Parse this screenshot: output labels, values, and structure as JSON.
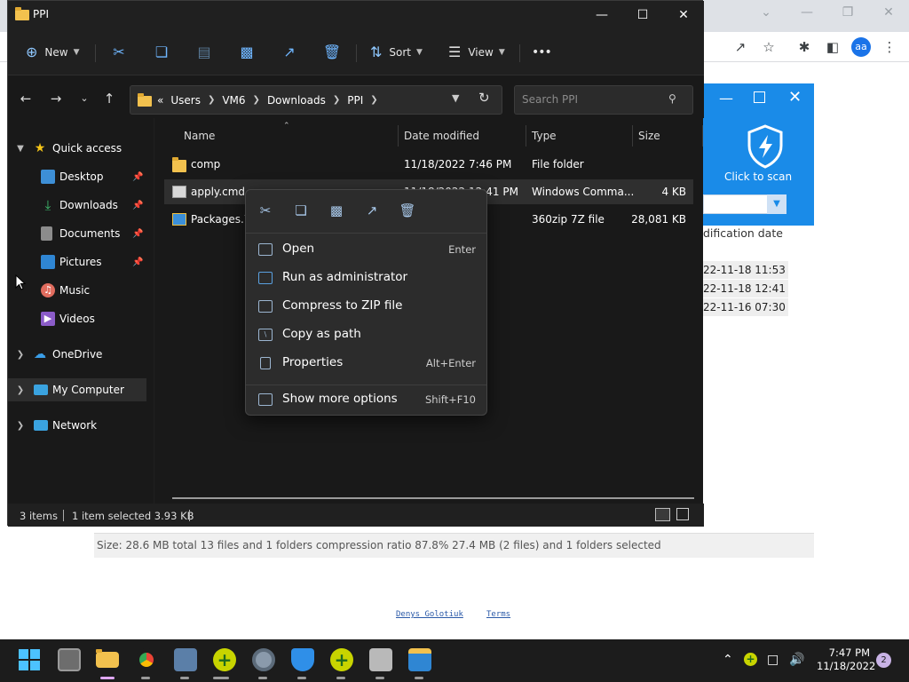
{
  "explorer": {
    "title": "PPI",
    "toolbar": {
      "new_label": "New",
      "sort_label": "Sort",
      "view_label": "View",
      "more_label": "•••"
    },
    "address": {
      "root": "«",
      "crumbs": [
        "Users",
        "VM6",
        "Downloads",
        "PPI"
      ]
    },
    "search": {
      "placeholder": "Search PPI"
    },
    "nav_pane": {
      "quick_access": "Quick access",
      "items": [
        "Desktop",
        "Downloads",
        "Documents",
        "Pictures",
        "Music",
        "Videos"
      ],
      "onedrive": "OneDrive",
      "my_computer": "My Computer",
      "network": "Network"
    },
    "columns": {
      "name": "Name",
      "date": "Date modified",
      "type": "Type",
      "size": "Size"
    },
    "files": [
      {
        "name": "comp",
        "date": "11/18/2022 7:46 PM",
        "type": "File folder",
        "size": ""
      },
      {
        "name": "apply.cmd",
        "date": "11/18/2022 12:41 PM",
        "type": "Windows Comma...",
        "size": "4 KB"
      },
      {
        "name": "Packages.7z",
        "date": "",
        "type": "360zip 7Z file",
        "size": "28,081 KB"
      }
    ],
    "status": {
      "items": "3 items",
      "selected": "1 item selected  3.93 KB"
    }
  },
  "context_menu": {
    "items": [
      {
        "label": "Open",
        "shortcut": "Enter"
      },
      {
        "label": "Run as administrator",
        "shortcut": ""
      },
      {
        "label": "Compress to ZIP file",
        "shortcut": ""
      },
      {
        "label": "Copy as path",
        "shortcut": ""
      },
      {
        "label": "Properties",
        "shortcut": "Alt+Enter"
      },
      {
        "label": "Show more options",
        "shortcut": "Shift+F10"
      }
    ]
  },
  "background": {
    "avatar": "aa",
    "av_scan_label": "Click to scan",
    "zip_column": "dification date",
    "zip_rows": [
      "22-11-18 11:53",
      "22-11-18 12:41",
      "22-11-16 07:30"
    ],
    "zip_status": "Size: 28.6 MB total 13 files and 1 folders compression ratio 87.8% 27.4 MB (2 files) and 1 folders selected",
    "footer_links": [
      "Denys Golotiuk",
      "Terms"
    ]
  },
  "taskbar": {
    "time": "7:47 PM",
    "date": "11/18/2022",
    "notifications": "2"
  },
  "colors": {
    "accent": "#1a8be8",
    "explorer_bg": "#202020",
    "folder": "#f2c14e"
  }
}
